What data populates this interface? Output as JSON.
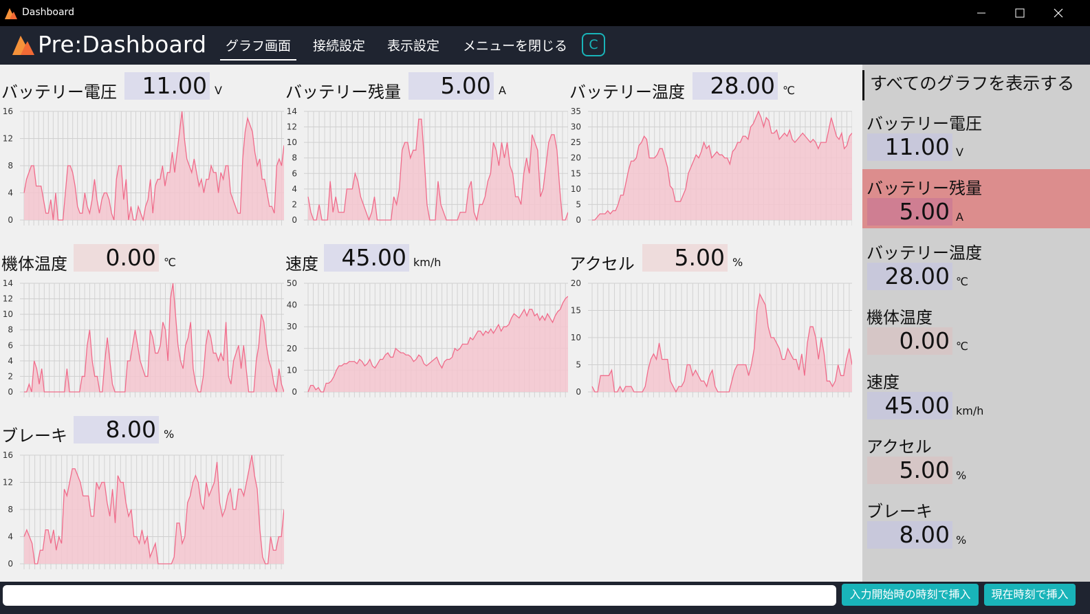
{
  "window": {
    "title": "Dashboard"
  },
  "navbar": {
    "brand": "Pre:Dashboard",
    "items": [
      {
        "label": "グラフ画面",
        "active": true
      },
      {
        "label": "接続設定"
      },
      {
        "label": "表示設定"
      },
      {
        "label": "メニューを閉じる"
      }
    ],
    "c_button": "C"
  },
  "panels": [
    {
      "label": "バッテリー電圧",
      "value": "11.00",
      "unit": "V",
      "box": "blue"
    },
    {
      "label": "バッテリー残量",
      "value": "5.00",
      "unit": "A",
      "box": "blue"
    },
    {
      "label": "バッテリー温度",
      "value": "28.00",
      "unit": "℃",
      "box": "blue"
    },
    {
      "label": "機体温度",
      "value": "0.00",
      "unit": "℃",
      "box": "pink"
    },
    {
      "label": "速度",
      "value": "45.00",
      "unit": "km/h",
      "box": "blue"
    },
    {
      "label": "アクセル",
      "value": "5.00",
      "unit": "%",
      "box": "pink"
    },
    {
      "label": "ブレーキ",
      "value": "8.00",
      "unit": "%",
      "box": "blue"
    }
  ],
  "sidebar": {
    "show_all": "すべてのグラフを表示する",
    "items": [
      {
        "label": "バッテリー電圧",
        "value": "11.00",
        "unit": "V",
        "box": "blue"
      },
      {
        "label": "バッテリー残量",
        "value": "5.00",
        "unit": "A",
        "box": "blue",
        "selected": true
      },
      {
        "label": "バッテリー温度",
        "value": "28.00",
        "unit": "℃",
        "box": "blue"
      },
      {
        "label": "機体温度",
        "value": "0.00",
        "unit": "℃",
        "box": "pink"
      },
      {
        "label": "速度",
        "value": "45.00",
        "unit": "km/h",
        "box": "blue"
      },
      {
        "label": "アクセル",
        "value": "5.00",
        "unit": "%",
        "box": "pink"
      },
      {
        "label": "ブレーキ",
        "value": "8.00",
        "unit": "%",
        "box": "blue"
      }
    ]
  },
  "bottombar": {
    "input_value": "",
    "button_start": "入力開始時の時刻で挿入",
    "button_now": "現在時刻で挿入"
  },
  "colors": {
    "line": "#f06b8a",
    "fill": "#f5c5cf",
    "accent": "#19b4b9",
    "selected": "#dc8d8d"
  },
  "chart_data": [
    {
      "type": "area",
      "name": "バッテリー電圧",
      "ylim": [
        0,
        16
      ],
      "yticks": [
        0,
        4,
        8,
        12,
        16
      ],
      "values": [
        4,
        6,
        7,
        8,
        8,
        5,
        5,
        5,
        3,
        1,
        1,
        3,
        0,
        4,
        0,
        0,
        0,
        4,
        8,
        8,
        7,
        5,
        2,
        1,
        1,
        4,
        2,
        1,
        3,
        6,
        3,
        1,
        3,
        4,
        4,
        3,
        1,
        0,
        6,
        8,
        8,
        3,
        6,
        0,
        2,
        0,
        0,
        2,
        1,
        0,
        2,
        3,
        6,
        1,
        5,
        6,
        6,
        8,
        5,
        7,
        7,
        10,
        7,
        10,
        13,
        16,
        12,
        9,
        8,
        7,
        9,
        7,
        5,
        6,
        4,
        6,
        6,
        8,
        7,
        7,
        4,
        7,
        6,
        8,
        8,
        4,
        3,
        2,
        1,
        1,
        9,
        13,
        15,
        14,
        13,
        10,
        8,
        9,
        6,
        6,
        4,
        2,
        2,
        1,
        8,
        9,
        8,
        11
      ]
    },
    {
      "type": "area",
      "name": "バッテリー残量",
      "ylim": [
        0,
        14
      ],
      "yticks": [
        0,
        2,
        4,
        6,
        8,
        10,
        12,
        14
      ],
      "values": [
        3,
        1,
        0,
        0,
        2,
        0,
        0,
        0,
        5,
        1,
        3,
        1,
        1,
        1,
        4,
        4,
        4,
        6,
        5,
        3,
        2,
        1,
        0,
        1,
        3,
        0,
        0,
        0,
        0,
        0,
        0,
        3,
        2,
        4,
        9,
        10,
        10,
        8,
        9,
        9,
        13,
        13,
        8,
        2,
        0,
        0,
        0,
        5,
        2,
        1,
        0,
        0,
        0,
        0,
        0,
        1,
        1,
        1,
        4,
        5,
        1,
        0,
        2,
        2,
        3,
        5,
        6,
        10,
        9,
        7,
        10,
        8,
        10,
        7,
        6,
        3,
        3,
        2,
        6,
        8,
        6,
        11,
        10,
        9,
        3,
        4,
        7,
        10,
        11,
        11,
        9,
        4,
        0,
        0,
        1
      ]
    },
    {
      "type": "area",
      "name": "バッテリー温度",
      "ylim": [
        0,
        35
      ],
      "yticks": [
        0,
        5,
        10,
        15,
        20,
        25,
        30,
        35
      ],
      "values": [
        0,
        0,
        1,
        2,
        2,
        2,
        3,
        2,
        3,
        3,
        5,
        8,
        8,
        12,
        16,
        19,
        19,
        20,
        24,
        25,
        27,
        26,
        20,
        20,
        20,
        21,
        23,
        23,
        20,
        17,
        11,
        10,
        6,
        6,
        6,
        8,
        10,
        15,
        17,
        19,
        21,
        20,
        22,
        25,
        23,
        24,
        20,
        21,
        22,
        21,
        21,
        20,
        20,
        18,
        22,
        23,
        25,
        25,
        27,
        27,
        26,
        30,
        31,
        33,
        35,
        33,
        30,
        33,
        32,
        28,
        28,
        29,
        26,
        27,
        28,
        27,
        29,
        26,
        25,
        26,
        27,
        28,
        27,
        26,
        25,
        26,
        25,
        23,
        25,
        25,
        25,
        29,
        33,
        30,
        27,
        26,
        28,
        23,
        24,
        27,
        28
      ]
    },
    {
      "type": "area",
      "name": "機体温度",
      "ylim": [
        0,
        14
      ],
      "yticks": [
        0,
        2,
        4,
        6,
        8,
        10,
        12,
        14
      ],
      "values": [
        0,
        0,
        1,
        0,
        4,
        3,
        1,
        3,
        0,
        0,
        0,
        0,
        0,
        0,
        0,
        0,
        0,
        3,
        0,
        0,
        0,
        0,
        0,
        2,
        2,
        6,
        8,
        4,
        2,
        2,
        0,
        0,
        4,
        7,
        4,
        1,
        0,
        0,
        0,
        0,
        0,
        4,
        4,
        6,
        8,
        6,
        4,
        3,
        2,
        2,
        8,
        7,
        5,
        5,
        6,
        9,
        8,
        4,
        12,
        14,
        10,
        6,
        4,
        3,
        6,
        7,
        9,
        3,
        1,
        0,
        0,
        2,
        6,
        8,
        7,
        5,
        5,
        4,
        5,
        4,
        9,
        2,
        1,
        4,
        5,
        6,
        3,
        6,
        3,
        0,
        0,
        0,
        4,
        6,
        10,
        9,
        6,
        4,
        3,
        1,
        0,
        3,
        1,
        0
      ]
    },
    {
      "type": "area",
      "name": "速度",
      "ylim": [
        0,
        50
      ],
      "yticks": [
        0,
        10,
        20,
        30,
        40,
        50
      ],
      "values": [
        0,
        3,
        3,
        1,
        2,
        0,
        0,
        4,
        4,
        5,
        7,
        10,
        12,
        12,
        13,
        13,
        14,
        14,
        14,
        13,
        15,
        14,
        12,
        13,
        15,
        12,
        11,
        13,
        15,
        15,
        17,
        18,
        16,
        16,
        20,
        19,
        18,
        18,
        17,
        17,
        16,
        14,
        15,
        17,
        16,
        13,
        12,
        13,
        14,
        15,
        16,
        13,
        11,
        14,
        15,
        15,
        16,
        20,
        19,
        20,
        22,
        22,
        22,
        25,
        24,
        26,
        28,
        28,
        26,
        28,
        27,
        29,
        27,
        29,
        31,
        28,
        30,
        30,
        31,
        34,
        36,
        35,
        34,
        36,
        38,
        35,
        38,
        38,
        35,
        36,
        33,
        35,
        33,
        36,
        34,
        32,
        35,
        37,
        38,
        41,
        43,
        44
      ]
    },
    {
      "type": "area",
      "name": "アクセル",
      "ylim": [
        0,
        20
      ],
      "yticks": [
        0,
        5,
        10,
        15,
        20
      ],
      "values": [
        1,
        0,
        0,
        3,
        3,
        3,
        3,
        4,
        0,
        0,
        1,
        0,
        1,
        1,
        1,
        0,
        0,
        0,
        0,
        1,
        4,
        6,
        7,
        6,
        9,
        6,
        6,
        6,
        2,
        1,
        0,
        1,
        1,
        2,
        5,
        5,
        3,
        4,
        3,
        2,
        2,
        1,
        3,
        4,
        1,
        0,
        0,
        0,
        0,
        0,
        2,
        4,
        5,
        5,
        5,
        5,
        3,
        5,
        8,
        15,
        18,
        17,
        16,
        12,
        10,
        10,
        9,
        8,
        6,
        6,
        8,
        7,
        6,
        6,
        4,
        7,
        3,
        9,
        12,
        12,
        10,
        6,
        10,
        7,
        2,
        2,
        1,
        2,
        5,
        3,
        3,
        6,
        8,
        5
      ]
    },
    {
      "type": "area",
      "name": "ブレーキ",
      "ylim": [
        0,
        16
      ],
      "yticks": [
        0,
        4,
        8,
        12,
        16
      ],
      "values": [
        4,
        5,
        4,
        3,
        0,
        0,
        2,
        2,
        5,
        5,
        3,
        5,
        2,
        4,
        3,
        11,
        10,
        12,
        14,
        14,
        13,
        12,
        10,
        10,
        10,
        7,
        7,
        12,
        11,
        12,
        12,
        9,
        7,
        11,
        6,
        13,
        12,
        12,
        9,
        7,
        8,
        4,
        4,
        3,
        5,
        3,
        4,
        1,
        2,
        3,
        0,
        0,
        0,
        0,
        0,
        0,
        1,
        6,
        6,
        3,
        4,
        9,
        10,
        12,
        13,
        12,
        9,
        8,
        12,
        10,
        11,
        12,
        15,
        9,
        7,
        8,
        10,
        11,
        8,
        8,
        11,
        11,
        10,
        12,
        14,
        16,
        13,
        11,
        5,
        1,
        0,
        0,
        4,
        2,
        2,
        4,
        4,
        8
      ]
    }
  ]
}
